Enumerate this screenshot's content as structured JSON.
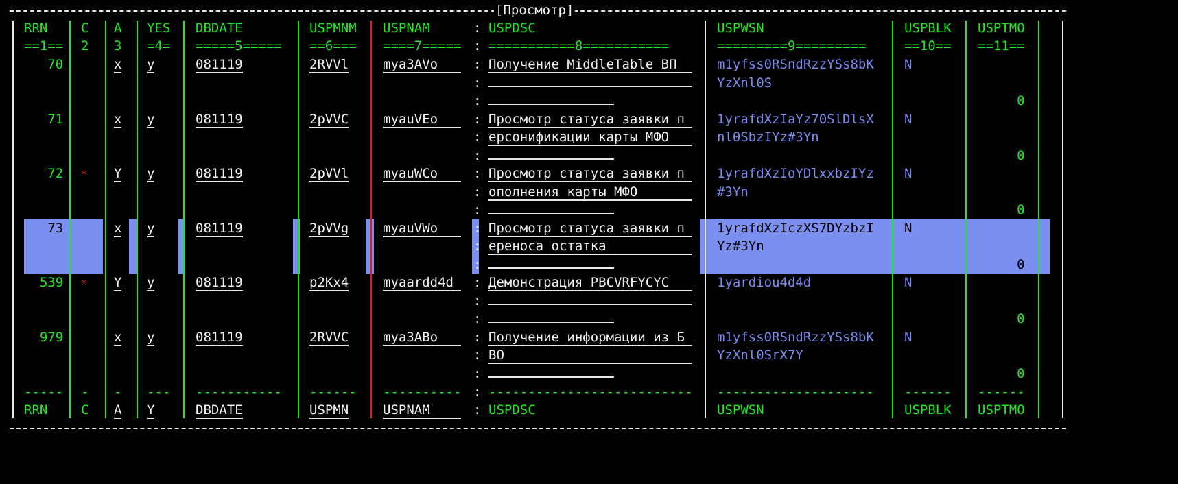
{
  "window": {
    "title": "[Просмотр]"
  },
  "columns": {
    "headers": [
      "RRN",
      "C",
      "A",
      "YES",
      "DBDATE",
      "USPMNM",
      "USPNAM",
      ":",
      "USPDSC",
      "USPWSN",
      "USPBLK",
      "USPTMO"
    ],
    "rulers": [
      "==1==",
      "2",
      "3",
      "=4=",
      "=====5=====",
      "==6===",
      "====7=====",
      ":",
      "===========8===========",
      "=========9=========",
      "==10==",
      "==11=="
    ]
  },
  "rows": [
    {
      "rrn": "70",
      "c": "",
      "a": "x",
      "yes": "y",
      "dbdate": "081119",
      "uspmnm": "2RVVl",
      "uspnam": "mya3AVo",
      "uspdsc": [
        "Получение MiddleTable ВП",
        "",
        ""
      ],
      "uspwsn": [
        "m1yfss0RSndRzzYSs8bK",
        "YzXnl0S"
      ],
      "uspblk": "N",
      "usptmo": "0",
      "selected": false
    },
    {
      "rrn": "71",
      "c": "",
      "a": "x",
      "yes": "y",
      "dbdate": "081119",
      "uspmnm": "2pVVC",
      "uspnam": "myauVEo",
      "uspdsc": [
        "Просмотр статуса заявки п",
        "ерсонификации карты МФО",
        ""
      ],
      "uspwsn": [
        "1yrafdXzIaYz70SlDlsX",
        "nl0SbzIYz#3Yn"
      ],
      "uspblk": "N",
      "usptmo": "0",
      "selected": false
    },
    {
      "rrn": "72",
      "c": "*",
      "a": "Y",
      "yes": "y",
      "dbdate": "081119",
      "uspmnm": "2pVVl",
      "uspnam": "myauWCo",
      "uspdsc": [
        "Просмотр статуса заявки п",
        "ополнения карты МФО",
        ""
      ],
      "uspwsn": [
        "1yrafdXzIoYDlxxbzIYz",
        "#3Yn"
      ],
      "uspblk": "N",
      "usptmo": "0",
      "selected": false
    },
    {
      "rrn": "73",
      "c": "",
      "a": "x",
      "yes": "y",
      "dbdate": "081119",
      "uspmnm": "2pVVg",
      "uspnam": "myauVWo",
      "uspdsc": [
        "Просмотр статуса заявки п",
        "ереноса остатка",
        ""
      ],
      "uspwsn": [
        "1yrafdXzIczXS7DYzbzI",
        "Yz#3Yn"
      ],
      "uspblk": "N",
      "usptmo": "0",
      "selected": true
    },
    {
      "rrn": "539",
      "c": "*",
      "a": "Y",
      "yes": "y",
      "dbdate": "081119",
      "uspmnm": "p2Kx4",
      "uspnam": "myaardd4d",
      "uspdsc": [
        "Демонстрация PBCVRFYCYC",
        "",
        ""
      ],
      "uspwsn": [
        "1yardiou4d4d"
      ],
      "uspblk": "N",
      "usptmo": "0",
      "selected": false
    },
    {
      "rrn": "979",
      "c": "",
      "a": "x",
      "yes": "y",
      "dbdate": "081119",
      "uspmnm": "2RVVC",
      "uspnam": "mya3ABo",
      "uspdsc": [
        "Получение информации из Б",
        "ВО",
        ""
      ],
      "uspwsn": [
        "m1yfss0RSndRzzYSs8bK",
        "YzXnl0SrX7Y"
      ],
      "uspblk": "N",
      "usptmo": "0",
      "selected": false
    }
  ],
  "footer": {
    "dashes": [
      "-----",
      "-",
      "-",
      "---",
      "-----------",
      "------",
      "----------",
      ":",
      "--------------------------",
      "--------------------",
      "------",
      "------"
    ],
    "labels": [
      "RRN",
      "C",
      "A",
      "Y",
      "DBDATE",
      "USPMN",
      "USPNAM",
      ":",
      "USPDSC",
      "USPWSN",
      "USPBLK",
      "USPTMO"
    ]
  },
  "colors": {
    "field_text": "#f2f2f2",
    "header": "#1ee81e",
    "link_text": "#7b8cf0",
    "marker": "#ff2a2a",
    "selection": "#7b8ff0"
  }
}
